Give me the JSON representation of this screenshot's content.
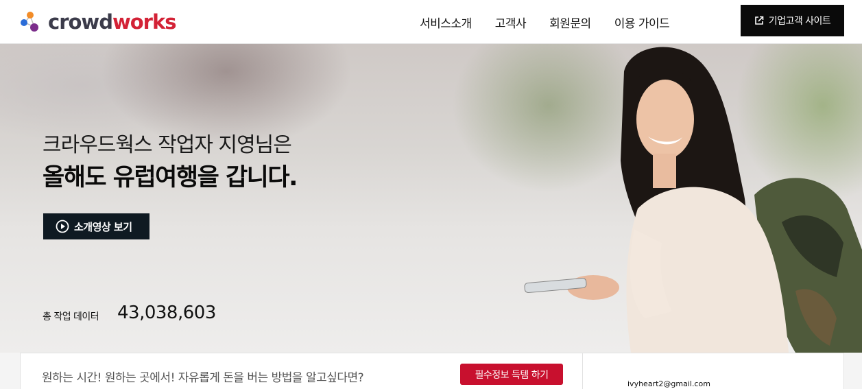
{
  "header": {
    "logo": {
      "part1": "crowd",
      "part2": "works"
    },
    "nav": [
      {
        "label": "서비스소개"
      },
      {
        "label": "고객사"
      },
      {
        "label": "회원문의"
      },
      {
        "label": "이용 가이드"
      }
    ],
    "corp_button_label": "기업고객 사이트",
    "corp_button_icon": "external-link-icon"
  },
  "hero": {
    "line1": "크라우드웍스 작업자 지영님은",
    "line2": "올해도 유럽여행을 갑니다.",
    "video_button_label": "소개영상 보기",
    "video_button_icon": "play-circle-icon",
    "stat_label": "총 작업 데이터",
    "stat_value": "43,038,603"
  },
  "strip": {
    "promo_text": "원하는 시간! 원하는 곳에서! 자유롭게 돈을 버는 방법을 알고싶다면?",
    "benefit_button_label": "필수정보 득템 하기",
    "email": "ivyheart2@gmail.com"
  },
  "colors": {
    "brand_dark": "#3b3b4a",
    "brand_red": "#d32236",
    "button_dark": "#0a0a0a",
    "video_button_bg": "#0f1a22",
    "benefit_button_bg": "#c8102e"
  }
}
